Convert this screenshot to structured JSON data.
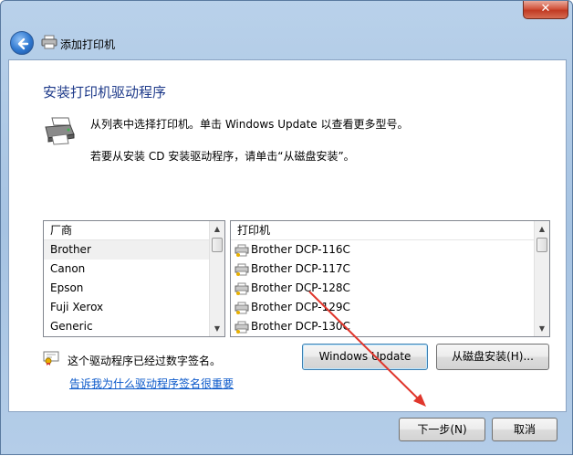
{
  "window": {
    "title": "添加打印机",
    "close_glyph": "✕"
  },
  "page": {
    "heading": "安装打印机驱动程序",
    "description_line1": "从列表中选择打印机。单击 Windows Update 以查看更多型号。",
    "description_line2": "若要从安装 CD 安装驱动程序，请单击“从磁盘安装”。"
  },
  "manufacturer_list": {
    "header": "厂商",
    "items": [
      "Brother",
      "Canon",
      "Epson",
      "Fuji Xerox",
      "Generic"
    ],
    "selected": "Brother"
  },
  "printer_list": {
    "header": "打印机",
    "items": [
      "Brother DCP-116C",
      "Brother DCP-117C",
      "Brother DCP-128C",
      "Brother DCP-129C",
      "Brother DCP-130C"
    ]
  },
  "buttons": {
    "windows_update": "Windows Update",
    "have_disk": "从磁盘安装(H)...",
    "next": "下一步(N)",
    "cancel": "取消"
  },
  "signature": {
    "status_text": "这个驱动程序已经过数字签名。",
    "link_text": "告诉我为什么驱动程序签名很重要"
  },
  "colors": {
    "heading": "#1e3a8a",
    "link": "#0a58ca",
    "annotation_arrow": "#e0362c"
  },
  "icons": {
    "back": "back-arrow-icon",
    "printer": "printer-icon",
    "driver": "printer-driver-icon",
    "shield": "certificate-icon"
  }
}
